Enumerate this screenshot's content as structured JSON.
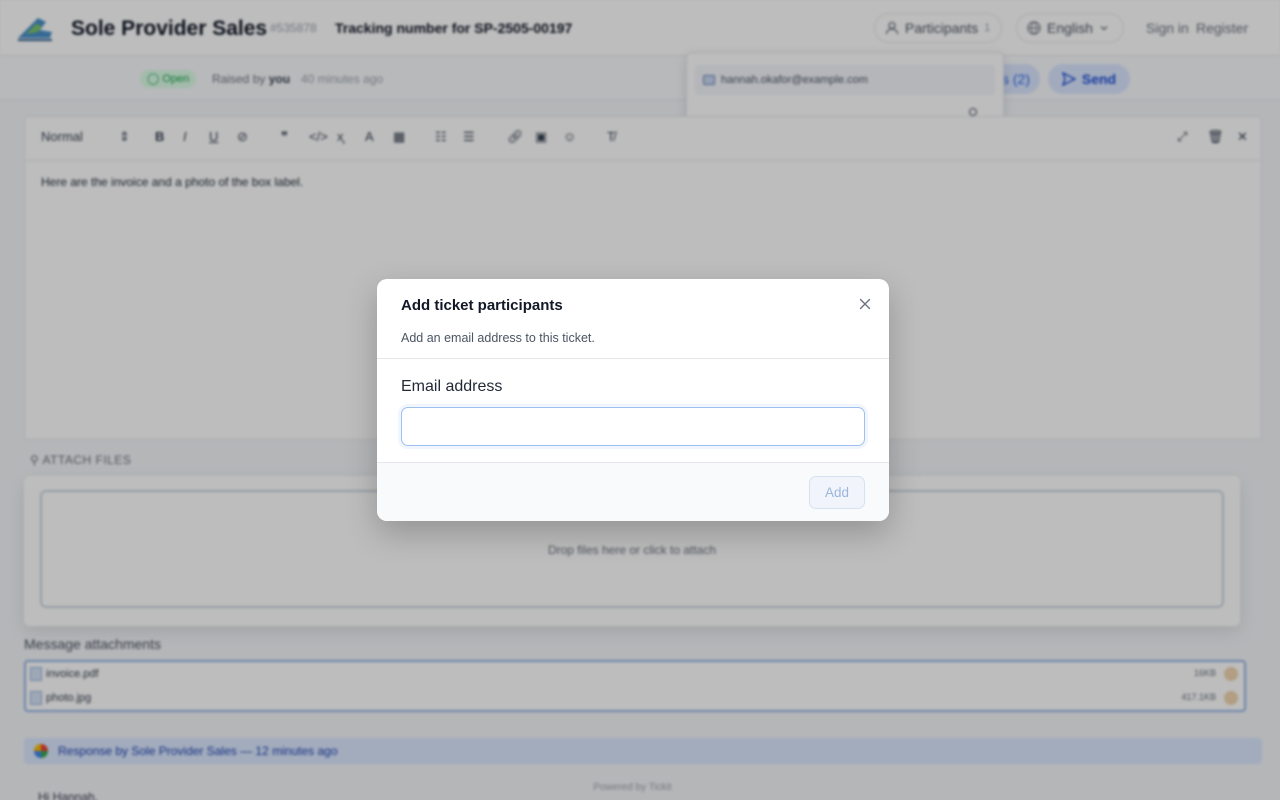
{
  "header": {
    "brand": "Sole Provider Sales",
    "ticket_id": "#535878",
    "ticket_title": "Tracking number for SP-2505-00197",
    "participants_label": "Participants",
    "participants_count": "1",
    "language_label": "English",
    "sign_in": "Sign in",
    "register": "Register"
  },
  "subheader": {
    "status": "Open",
    "raised_by_prefix": "Raised by",
    "raised_by": "you",
    "time_ago": "40 minutes ago",
    "files_label": "s (2)",
    "send_label": "Send"
  },
  "participants_dropdown": {
    "email": "hannah.okafor@example.com"
  },
  "editor": {
    "format_label": "Normal",
    "body": "Here are the invoice and a photo of the box label."
  },
  "attach": {
    "section_label": "ATTACH FILES",
    "drop_text": "Drop files here or click to attach"
  },
  "message_attachments": {
    "title": "Message attachments",
    "files": [
      {
        "name": "invoice.pdf",
        "size": "16KB"
      },
      {
        "name": "photo.jpg",
        "size": "417.1KB"
      }
    ]
  },
  "response": {
    "text": "Response by Sole Provider Sales — 12 minutes ago",
    "powered_by": "Powered by Tickit",
    "greeting": "Hi Hannah,"
  },
  "modal": {
    "title": "Add ticket participants",
    "description": "Add an email address to this ticket.",
    "field_label": "Email address",
    "email_value": "",
    "add_button": "Add"
  }
}
